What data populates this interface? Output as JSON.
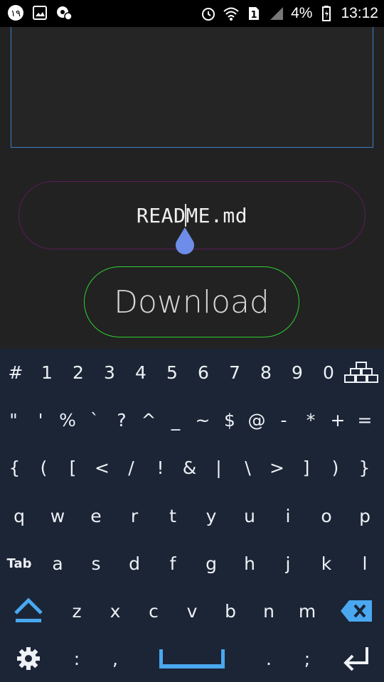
{
  "status_bar": {
    "notif_badge": "١٩",
    "battery": "4%",
    "sim": "1",
    "time": "13:12"
  },
  "editor": {
    "filename": "README.md",
    "download_label": "Download"
  },
  "keyboard": {
    "rows": [
      [
        "#",
        "1",
        "2",
        "3",
        "4",
        "5",
        "6",
        "7",
        "8",
        "9",
        "0"
      ],
      [
        "\"",
        "'",
        "%",
        "`",
        "?",
        "^",
        "_",
        "~",
        "$",
        "@",
        "-",
        "*",
        "+",
        "="
      ],
      [
        "{",
        "(",
        "[",
        "<",
        "/",
        "!",
        "&",
        "|",
        "\\",
        ">",
        "]",
        ")",
        "}"
      ],
      [
        "q",
        "w",
        "e",
        "r",
        "t",
        "y",
        "u",
        "i",
        "o",
        "p"
      ],
      [
        "Tab",
        "a",
        "s",
        "d",
        "f",
        "g",
        "h",
        "j",
        "k",
        "l"
      ],
      [
        "z",
        "x",
        "c",
        "v",
        "b",
        "n",
        "m"
      ],
      [
        ":",
        ",",
        ".",
        ";"
      ]
    ],
    "accent_color": "#4aa8f0"
  }
}
